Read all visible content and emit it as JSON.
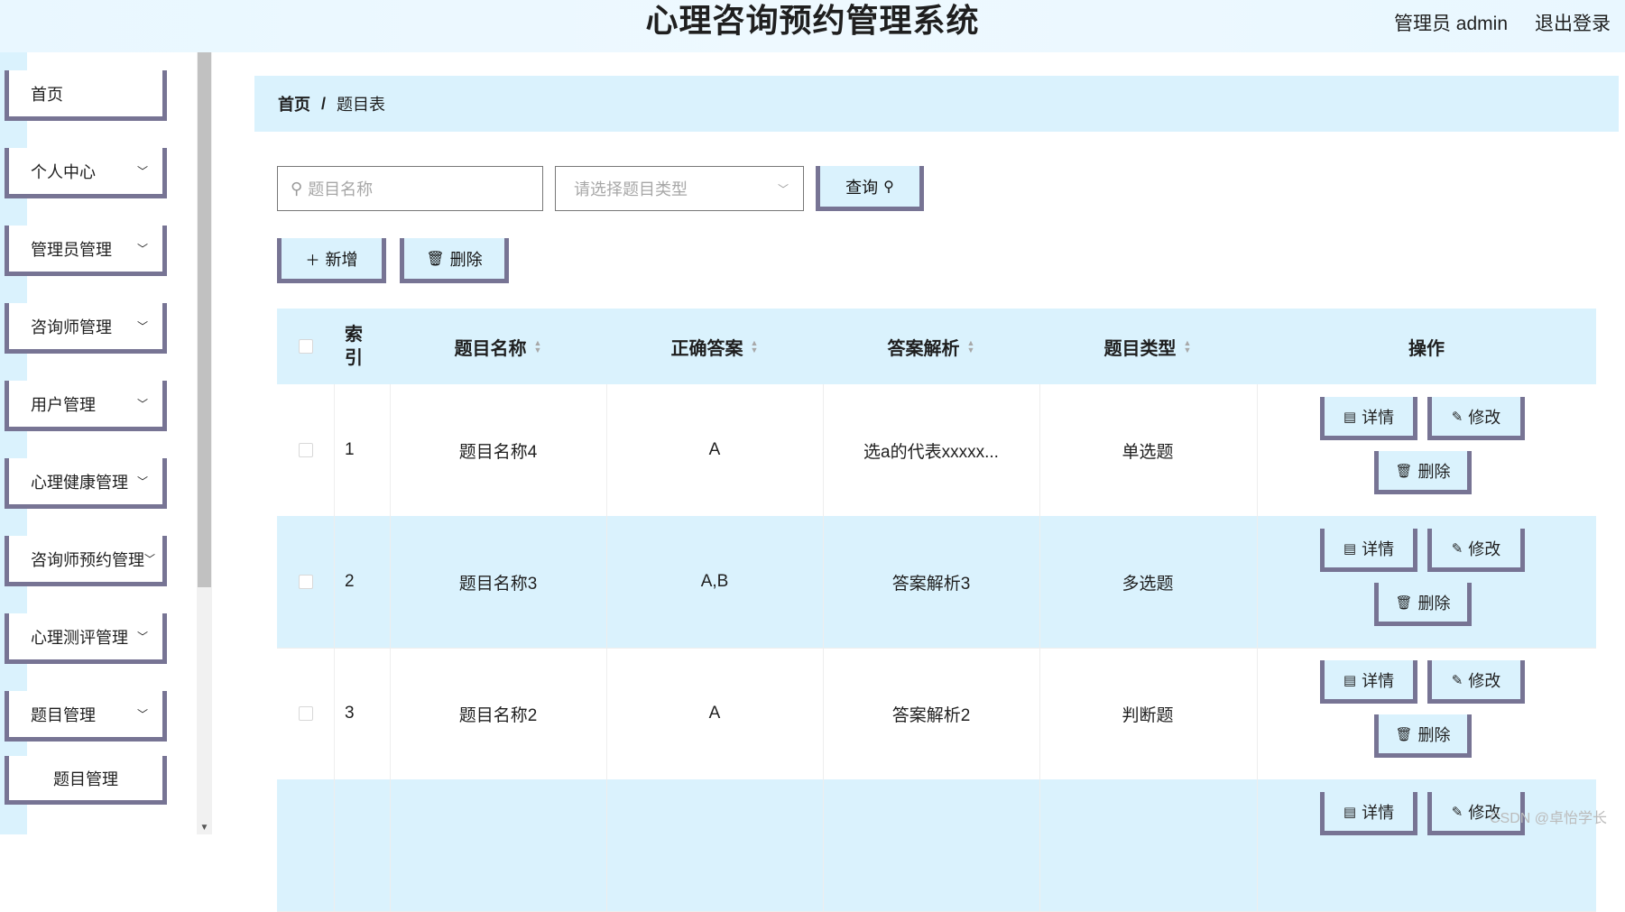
{
  "header": {
    "title": "心理咨询预约管理系统",
    "user": "管理员 admin",
    "logout": "退出登录"
  },
  "sidebar": {
    "items": [
      {
        "label": "首页",
        "has_children": false
      },
      {
        "label": "个人中心",
        "has_children": true
      },
      {
        "label": "管理员管理",
        "has_children": true
      },
      {
        "label": "咨询师管理",
        "has_children": true
      },
      {
        "label": "用户管理",
        "has_children": true
      },
      {
        "label": "心理健康管理",
        "has_children": true
      },
      {
        "label": "咨询师预约管理",
        "has_children": true
      },
      {
        "label": "心理测评管理",
        "has_children": true
      },
      {
        "label": "题目管理",
        "has_children": true
      }
    ],
    "subitem": "题目管理"
  },
  "breadcrumb": {
    "home": "首页",
    "sep": "/",
    "current": "题目表"
  },
  "search": {
    "name_placeholder": "题目名称",
    "type_placeholder": "请选择题目类型",
    "query_label": "查询"
  },
  "actions": {
    "add_label": "新增",
    "delete_label": "删除"
  },
  "table": {
    "headers": {
      "index": "索引",
      "name": "题目名称",
      "answer": "正确答案",
      "analysis": "答案解析",
      "type": "题目类型",
      "ops": "操作"
    },
    "rows": [
      {
        "index": "1",
        "name": "题目名称4",
        "answer": "A",
        "analysis": "选a的代表xxxxx...",
        "type": "单选题"
      },
      {
        "index": "2",
        "name": "题目名称3",
        "answer": "A,B",
        "analysis": "答案解析3",
        "type": "多选题"
      },
      {
        "index": "3",
        "name": "题目名称2",
        "answer": "A",
        "analysis": "答案解析2",
        "type": "判断题"
      },
      {
        "index": "",
        "name": "",
        "answer": "",
        "analysis": "",
        "type": ""
      }
    ],
    "op_labels": {
      "detail": "详情",
      "edit": "修改",
      "delete": "删除"
    }
  },
  "watermark": "CSDN @卓怡学长",
  "colors": {
    "accent": "#daf2fd",
    "border": "#777494"
  }
}
